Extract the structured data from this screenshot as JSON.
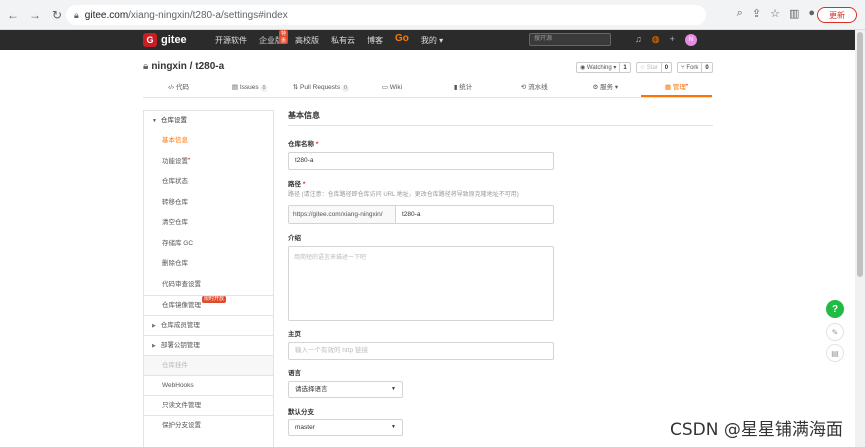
{
  "browser": {
    "url_host": "gitee.com",
    "url_path": "/xiang-ningxin/t280-a/settings#index",
    "update_label": "更新"
  },
  "header": {
    "brand": "gitee",
    "nav": [
      "开源软件",
      "企业版",
      "高校版",
      "私有云",
      "博客"
    ],
    "enterprise_badge": "特惠",
    "go_label": "Go",
    "my_label": "我的",
    "search_placeholder": "搜开源"
  },
  "repo": {
    "owner": "ningxin",
    "name": "t280-a",
    "separator": "/",
    "watching_label": "Watching",
    "watching_count": "1",
    "star_label": "Star",
    "star_count": "0",
    "fork_label": "Fork",
    "fork_count": "0"
  },
  "tabs": [
    {
      "label": "代码"
    },
    {
      "label": "Issues",
      "count": "0"
    },
    {
      "label": "Pull Requests",
      "count": "0"
    },
    {
      "label": "Wiki"
    },
    {
      "label": "统计"
    },
    {
      "label": "流水线"
    },
    {
      "label": "服务"
    },
    {
      "label": "管理"
    }
  ],
  "sidebar": {
    "group_title": "仓库设置",
    "items": [
      "基本信息",
      "功能设置",
      "仓库状态",
      "转移仓库",
      "清空仓库",
      "存储库 GC",
      "删除仓库",
      "代码审查设置"
    ],
    "mirror": "仓库镜像管理",
    "mirror_badge": "限时开放",
    "members": "仓库成员管理",
    "keys": "部署公钥管理",
    "plugins": "仓库挂件",
    "webhooks": "WebHooks",
    "readonly": "只读文件管理",
    "protected": "保护分支设置"
  },
  "form": {
    "section_title": "基本信息",
    "name_label": "仓库名称",
    "name_value": "t280-a",
    "path_label": "路径",
    "path_hint": "路径 (请注意：仓库路径即仓库访问 URL 地址，更改仓库路径将导致原克隆地址不可用)",
    "path_prefix": "https://gitee.com/xiang-ningxin/",
    "path_value": "t280-a",
    "intro_label": "介绍",
    "intro_placeholder": "用简短的语言来描述一下吧",
    "homepage_label": "主页",
    "homepage_placeholder": "输入一个有效的 http 链接",
    "language_label": "语言",
    "language_value": "请选择语言",
    "branch_label": "默认分支",
    "branch_value": "master"
  },
  "float": {
    "help": "?"
  },
  "watermark": "CSDN @星星铺满海面"
}
